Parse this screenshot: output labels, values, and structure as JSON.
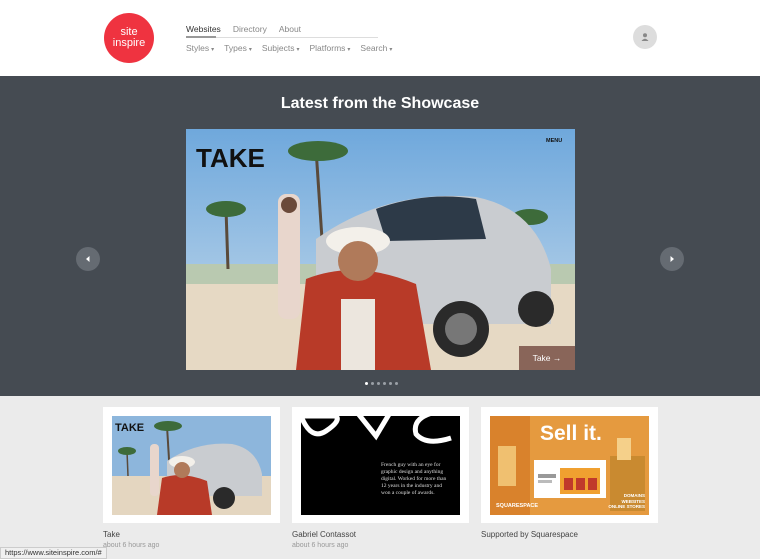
{
  "logo": {
    "line1": "site",
    "line2": "inspire"
  },
  "nav": {
    "top": [
      "Websites",
      "Directory",
      "About"
    ],
    "bottom": [
      "Styles",
      "Types",
      "Subjects",
      "Platforms",
      "Search"
    ],
    "caret": "▾"
  },
  "showcase": {
    "title": "Latest from the Showcase",
    "hero_logo": "TAKE",
    "hero_menu": "MENU",
    "cta": "Take →"
  },
  "cards": [
    {
      "title": "Take",
      "time": "about 6 hours ago"
    },
    {
      "title": "Gabriel Contassot",
      "time": "about 6 hours ago",
      "thumb_text": "French guy with an eye for graphic design and anything digital. Worked for more than 12 years in the industry and won a couple of awards."
    },
    {
      "title": "Supported by Squarespace",
      "thumb_headline": "Sell it.",
      "thumb_brand": "SQUARESPACE",
      "thumb_tags": [
        "DOMAINS",
        "WEBSITES",
        "ONLINE STORES"
      ]
    }
  ],
  "status_bar": "https://www.siteinspire.com/#"
}
